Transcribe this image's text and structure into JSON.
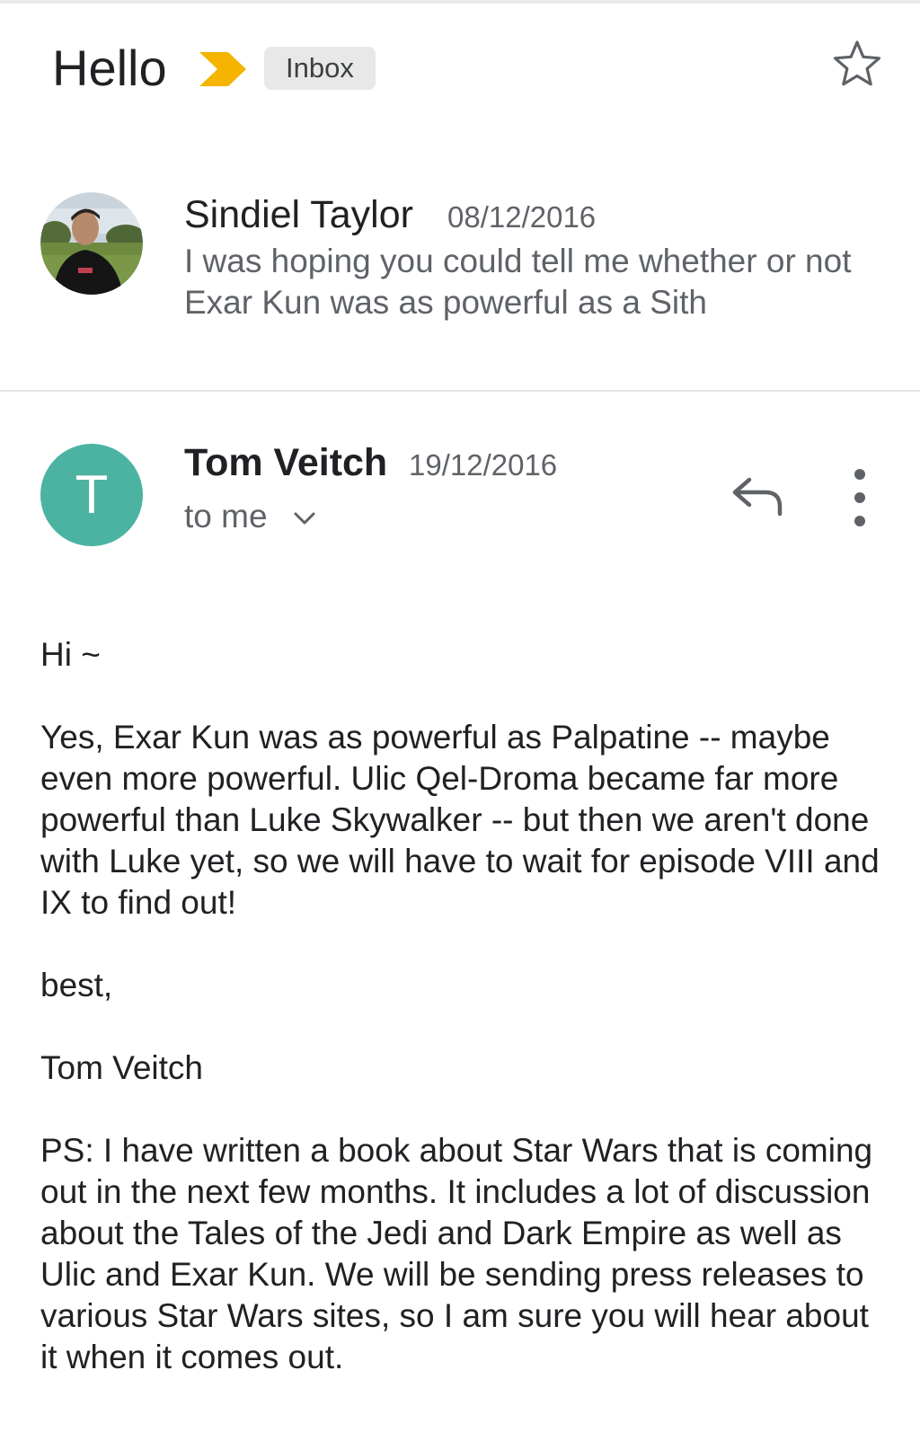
{
  "header": {
    "subject": "Hello",
    "label": "Inbox",
    "important_icon": "important-marker-icon",
    "star_icon": "star-outline-icon"
  },
  "messages": [
    {
      "sender": "Sindiel Taylor",
      "date": "08/12/2016",
      "snippet": "I was hoping you could tell me whether or not Exar Kun was as powerful as a Sith",
      "avatar": "profile-photo"
    },
    {
      "sender": "Tom Veitch",
      "date": "19/12/2016",
      "avatar_letter": "T",
      "recipient": "to me",
      "actions": [
        "reply-icon",
        "more-vert-icon"
      ],
      "body": [
        "Hi ~",
        "Yes, Exar Kun was as powerful as Palpatine -- maybe even more powerful. Ulic Qel-Droma became far more powerful than Luke Skywalker -- but then we aren't done with Luke yet, so we will have to wait for episode VIII and IX to find out!",
        "best,",
        "Tom Veitch",
        "PS: I have written a book about Star Wars that is coming out in the next few months. It includes a lot of discussion about the Tales of the Jedi and Dark Empire as well as Ulic and Exar Kun. We will be sending press releases to various Star Wars sites, so I am sure you will hear about it when it comes out."
      ]
    }
  ],
  "colors": {
    "important": "#f4b400",
    "avatar_teal": "#4cb3a3",
    "secondary_text": "#5f6368",
    "chip_bg": "#e8e8e8"
  }
}
